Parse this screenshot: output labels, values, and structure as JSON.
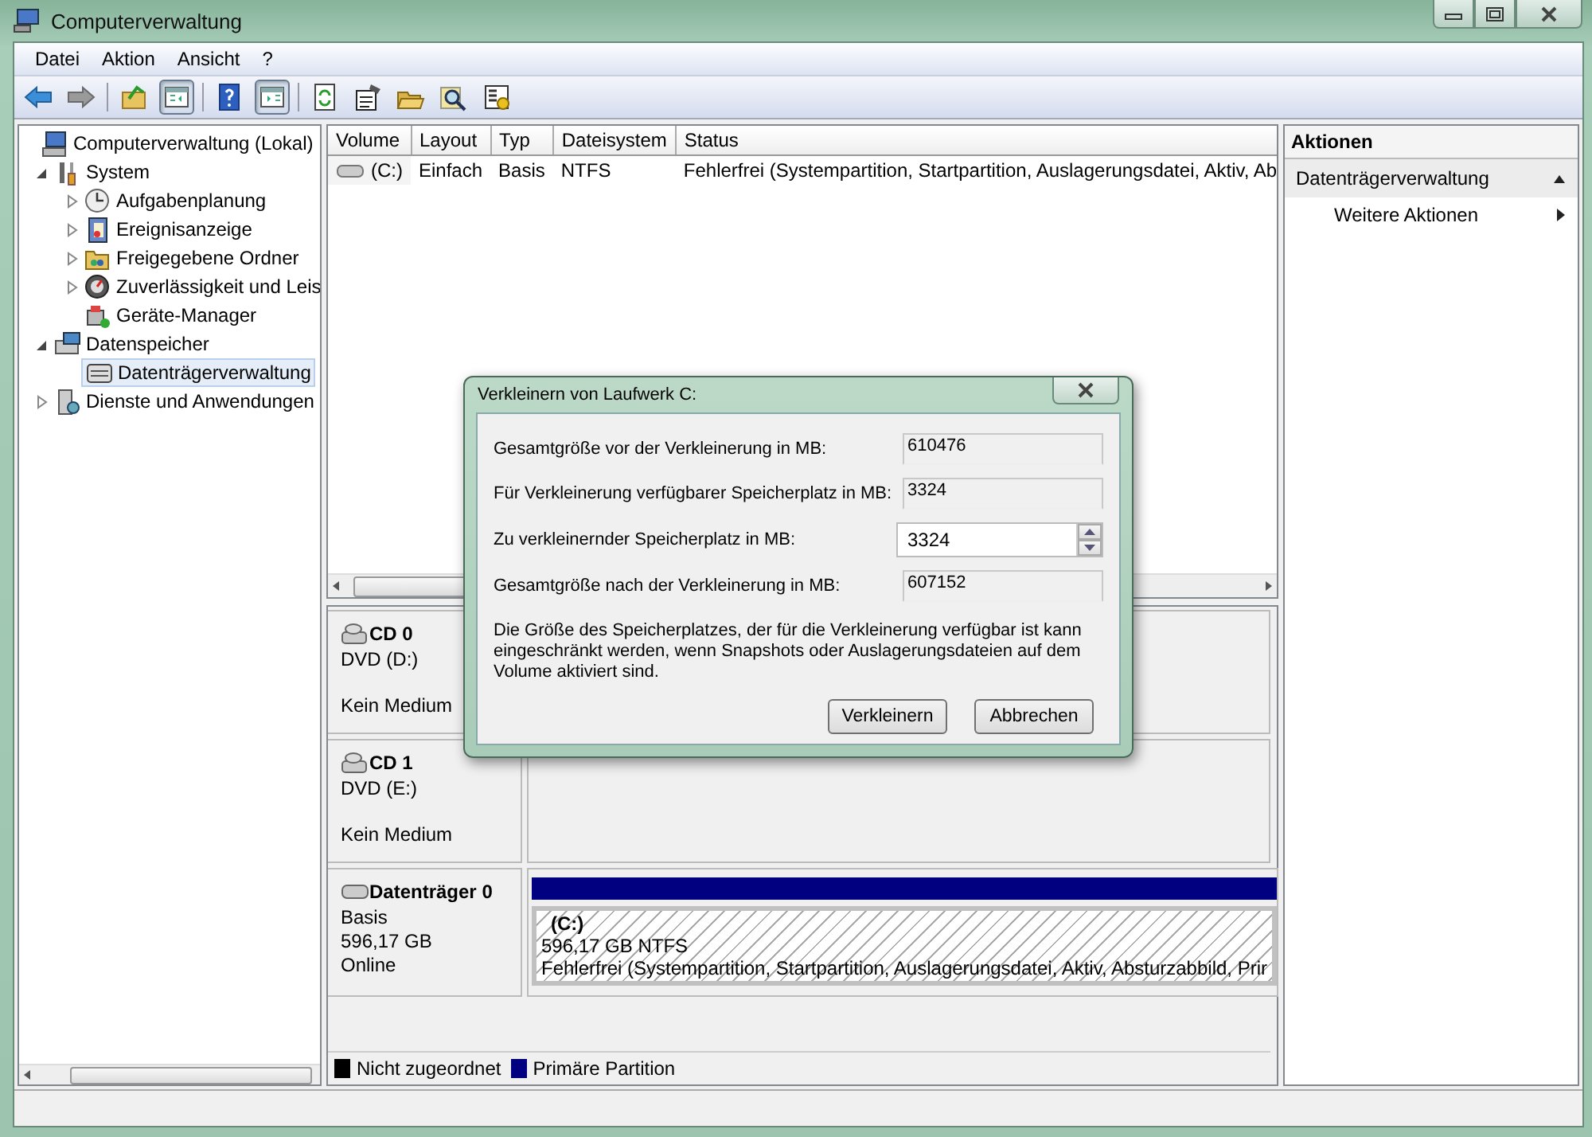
{
  "window": {
    "title": "Computerverwaltung"
  },
  "menu": [
    "Datei",
    "Aktion",
    "Ansicht",
    "?"
  ],
  "toolbar": [
    [
      {
        "kind": "back",
        "pressed": false
      },
      {
        "kind": "forward",
        "pressed": false
      }
    ],
    [
      {
        "kind": "up",
        "pressed": false
      },
      {
        "kind": "tree-toggle",
        "pressed": true
      }
    ],
    [
      {
        "kind": "help",
        "pressed": false
      },
      {
        "kind": "pane-toggle",
        "pressed": true
      }
    ],
    [
      {
        "kind": "refresh",
        "pressed": false
      },
      {
        "kind": "properties",
        "pressed": false
      },
      {
        "kind": "open",
        "pressed": false
      },
      {
        "kind": "find",
        "pressed": false
      },
      {
        "kind": "settings",
        "pressed": false
      }
    ]
  ],
  "tree": [
    {
      "label": "Computerverwaltung (Lokal)",
      "kind": "computer",
      "selected": false,
      "children": [
        {
          "label": "System",
          "kind": "tools",
          "expanded": true,
          "selected": false,
          "children": [
            {
              "label": "Aufgabenplanung",
              "kind": "clock",
              "expanded": false,
              "selected": false
            },
            {
              "label": "Ereignisanzeige",
              "kind": "log",
              "expanded": false,
              "selected": false
            },
            {
              "label": "Freigegebene Ordner",
              "kind": "folder",
              "expanded": false,
              "selected": false
            },
            {
              "label": "Zuverlässigkeit und Leis",
              "kind": "gauge",
              "expanded": false,
              "selected": false
            },
            {
              "label": "Geräte-Manager",
              "kind": "device",
              "selected": false
            }
          ]
        },
        {
          "label": "Datenspeicher",
          "kind": "storage",
          "expanded": true,
          "selected": false,
          "children": [
            {
              "label": "Datenträgerverwaltung",
              "kind": "disk",
              "selected": true
            }
          ]
        },
        {
          "label": "Dienste und Anwendungen",
          "kind": "services",
          "expanded": false,
          "selected": false
        }
      ]
    }
  ],
  "volumes": {
    "columns": [
      "Volume",
      "Layout",
      "Typ",
      "Dateisystem",
      "Status"
    ],
    "rows": [
      [
        "(C:)",
        "Einfach",
        "Basis",
        "NTFS",
        "Fehlerfrei (Systempartition, Startpartition, Auslagerungsdatei, Aktiv, Ab"
      ]
    ]
  },
  "disks": [
    {
      "kind": "cd",
      "name": "CD 0",
      "lines": [
        "DVD (D:)",
        "Kein Medium"
      ]
    },
    {
      "kind": "cd",
      "name": "CD 1",
      "lines": [
        "DVD (E:)",
        "Kein Medium"
      ]
    },
    {
      "kind": "hdd",
      "name": "Datenträger 0",
      "lines": [
        "Basis",
        "596,17 GB",
        "Online"
      ],
      "partition": {
        "name": "(C:)",
        "size": "596,17 GB NTFS",
        "status": "Fehlerfrei (Systempartition, Startpartition, Auslagerungsdatei, Aktiv, Absturzabbild, Prir",
        "color": "#000080"
      }
    }
  ],
  "legend": [
    {
      "label": "Nicht zugeordnet",
      "color": "#000000"
    },
    {
      "label": "Primäre Partition",
      "color": "#000080"
    }
  ],
  "actions": {
    "title": "Aktionen",
    "section": "Datenträgerverwaltung",
    "items": [
      "Weitere Aktionen"
    ]
  },
  "dialog": {
    "title": "Verkleinern von Laufwerk C:",
    "fields": [
      {
        "kind": "readonly",
        "label": "Gesamtgröße vor der Verkleinerung in MB:",
        "value": "610476"
      },
      {
        "kind": "readonly",
        "label": "Für Verkleinerung verfügbarer Speicherplatz in MB:",
        "value": "3324"
      },
      {
        "kind": "spin",
        "label": "Zu verkleinernder Speicherplatz in MB:",
        "value": "3324"
      },
      {
        "kind": "readonly",
        "label": "Gesamtgröße nach der Verkleinerung in MB:",
        "value": "607152"
      }
    ],
    "note": "Die Größe des Speicherplatzes, der für die Verkleinerung verfügbar ist kann eingeschränkt werden, wenn Snapshots oder Auslagerungsdateien auf dem Volume aktiviert sind.",
    "buttons": [
      "Verkleinern",
      "Abbrechen"
    ]
  }
}
